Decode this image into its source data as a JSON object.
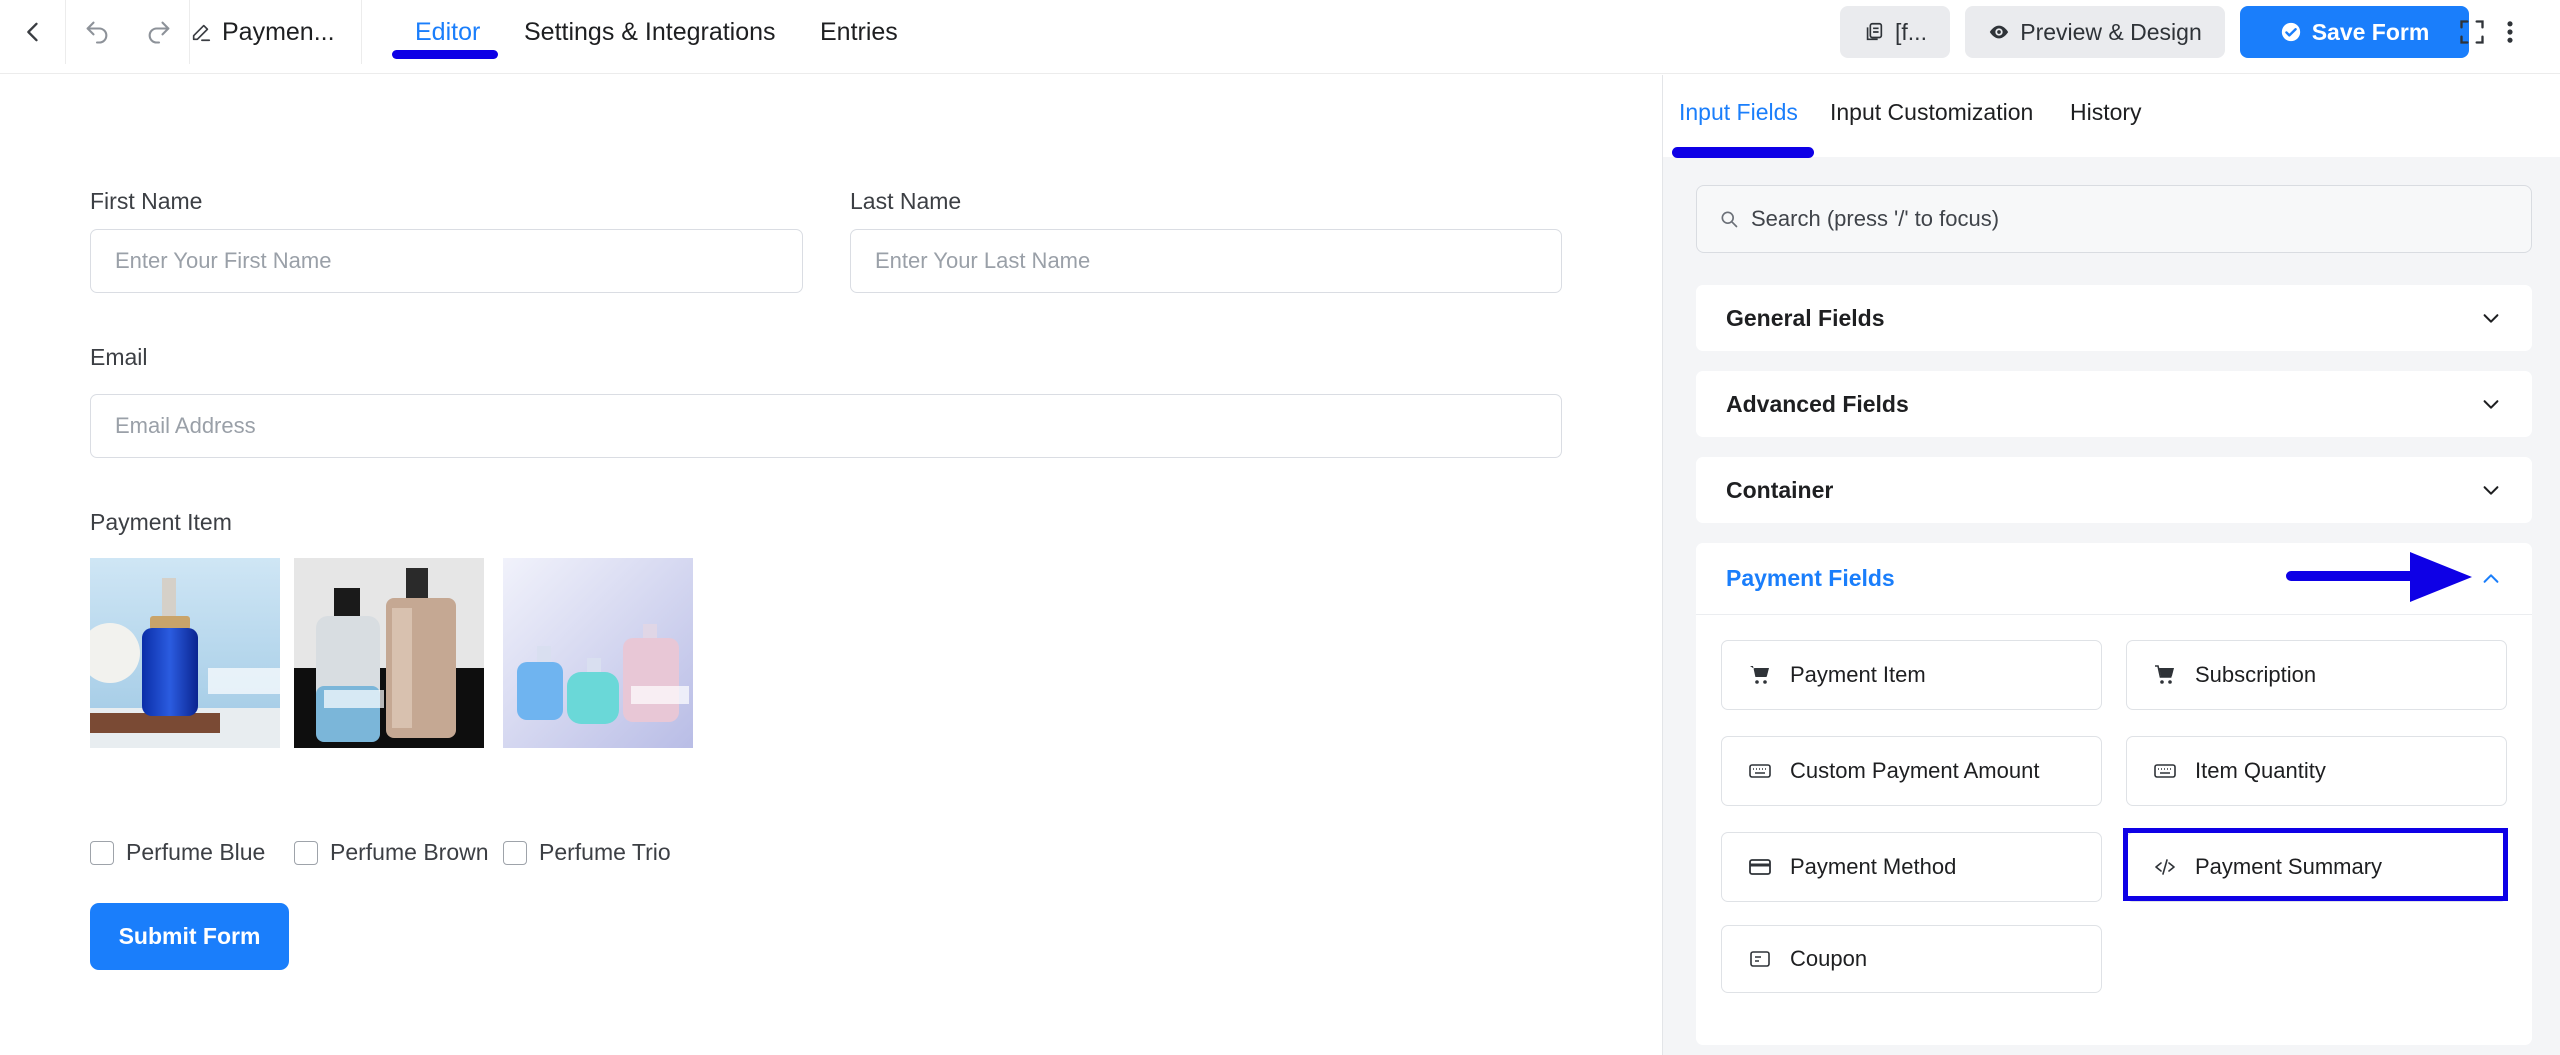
{
  "topbar": {
    "form_title": "Paymen...",
    "tabs": [
      {
        "label": "Editor",
        "active": true
      },
      {
        "label": "Settings & Integrations",
        "active": false
      },
      {
        "label": "Entries",
        "active": false
      }
    ],
    "shortcode_label": "[f...",
    "preview_label": "Preview & Design",
    "save_label": "Save Form",
    "icons": [
      "back-icon",
      "undo-icon",
      "redo-icon",
      "edit-icon",
      "copy-icon",
      "eye-icon",
      "check-circle-icon",
      "fullscreen-icon",
      "more-vertical-icon"
    ]
  },
  "form": {
    "first_name": {
      "label": "First Name",
      "placeholder": "Enter Your First Name"
    },
    "last_name": {
      "label": "Last Name",
      "placeholder": "Enter Your Last Name"
    },
    "email": {
      "label": "Email",
      "placeholder": "Email Address"
    },
    "payment_item": {
      "label": "Payment Item",
      "options": [
        {
          "label": "Perfume Blue",
          "checked": false
        },
        {
          "label": "Perfume Brown",
          "checked": false
        },
        {
          "label": "Perfume Trio",
          "checked": false
        }
      ]
    },
    "submit_label": "Submit Form"
  },
  "panel": {
    "tabs": [
      {
        "label": "Input Fields",
        "active": true
      },
      {
        "label": "Input Customization",
        "active": false
      },
      {
        "label": "History",
        "active": false
      }
    ],
    "search_placeholder": "Search (press '/' to focus)",
    "sections": [
      {
        "label": "General Fields",
        "open": false
      },
      {
        "label": "Advanced Fields",
        "open": false
      },
      {
        "label": "Container",
        "open": false
      },
      {
        "label": "Payment Fields",
        "open": true
      }
    ],
    "payment_fields": [
      {
        "label": "Payment Item",
        "icon": "cart-icon"
      },
      {
        "label": "Subscription",
        "icon": "cart-icon"
      },
      {
        "label": "Custom Payment Amount",
        "icon": "keyboard-icon"
      },
      {
        "label": "Item Quantity",
        "icon": "keyboard-icon"
      },
      {
        "label": "Payment Method",
        "icon": "credit-card-icon"
      },
      {
        "label": "Payment Summary",
        "icon": "code-icon",
        "highlighted": true
      },
      {
        "label": "Coupon",
        "icon": "coupon-icon"
      }
    ]
  },
  "colors": {
    "accent": "#1a7efb",
    "annotation": "#0e00e6"
  }
}
